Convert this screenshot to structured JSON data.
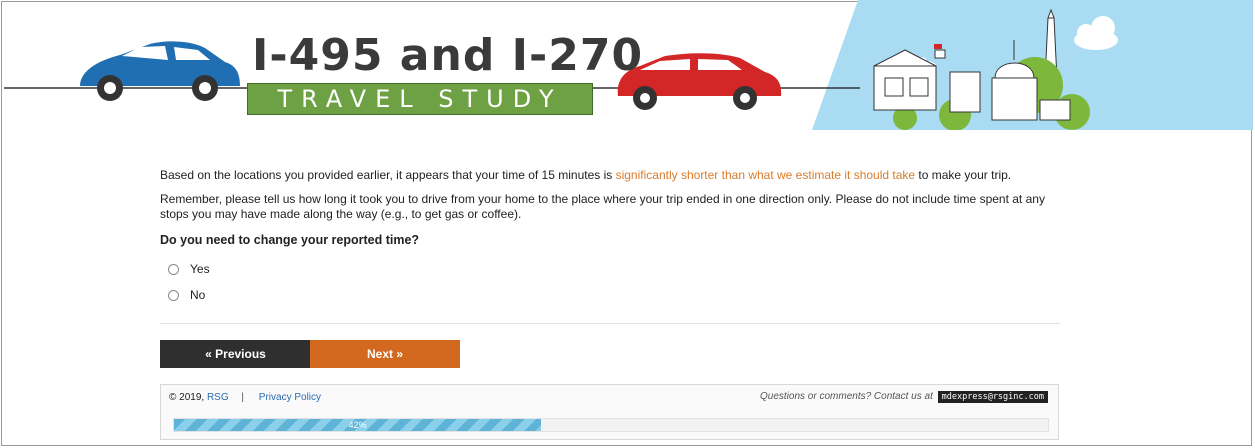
{
  "header": {
    "title": "I-495 and I-270",
    "subtitle": "TRAVEL STUDY",
    "colors": {
      "blue_car": "#1f6fb2",
      "red_car": "#d32626",
      "sky": "#a9dcf3",
      "tree": "#7db83d",
      "banner": "#6ea143"
    }
  },
  "survey": {
    "para1_pre": "Based on the locations you provided earlier, it appears that your time of 15 minutes is ",
    "para1_highlight": "significantly shorter than what we estimate it should take",
    "para1_post": " to make your trip.",
    "para2": "Remember, please tell us how long it took you to drive from your home to the place where your trip ended in one direction only. Please do not include time spent at any stops you may have made along the way (e.g., to get gas or coffee).",
    "question": "Do you need to change your reported time?",
    "options": [
      {
        "label": "Yes"
      },
      {
        "label": "No"
      }
    ]
  },
  "nav": {
    "previous_label": "« Previous",
    "next_label": "Next »"
  },
  "footer": {
    "copyright": "© 2019,",
    "org_link": "RSG",
    "separator": "|",
    "privacy_link": "Privacy Policy",
    "contact_text": "Questions or comments? Contact us at",
    "email": "mdexpress@rsginc.com"
  },
  "progress": {
    "percent": 42,
    "label": "42%"
  }
}
